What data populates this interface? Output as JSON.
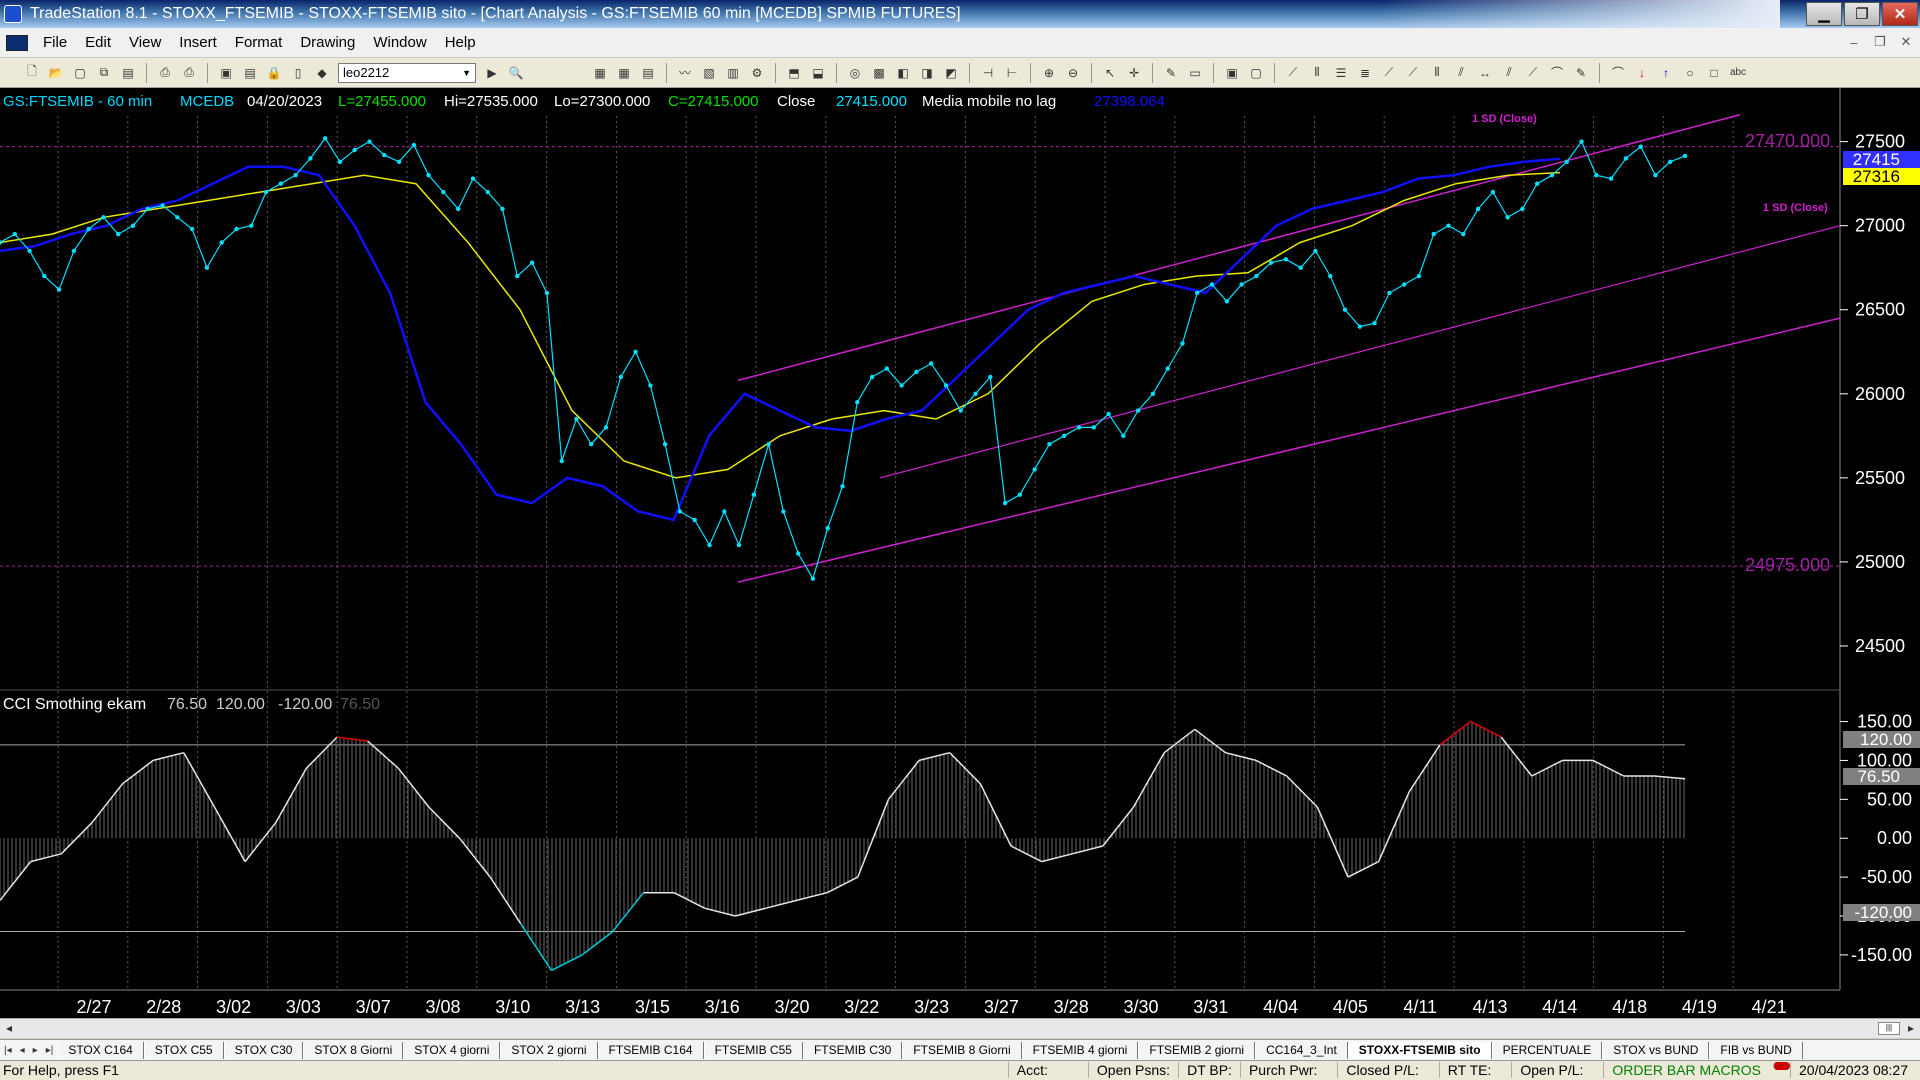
{
  "window": {
    "title": "TradeStation 8.1 - STOXX_FTSEMIB - STOXX-FTSEMIB sito - [Chart Analysis - GS:FTSEMIB  60 min  [MCEDB] SPMIB FUTURES]",
    "min": "▁",
    "max": "❐",
    "close": "✕"
  },
  "menu": [
    "File",
    "Edit",
    "View",
    "Insert",
    "Format",
    "Drawing",
    "Window",
    "Help"
  ],
  "toolbar": {
    "symbol": "leo2212"
  },
  "chart": {
    "header": {
      "symbol": "GS:FTSEMIB - 60 min",
      "exchange": "MCEDB",
      "date": "04/20/2023",
      "last": "L=27455.000",
      "hi": "Hi=27535.000",
      "lo": "Lo=27300.000",
      "close": "C=27415.000",
      "close_label": "Close",
      "close_value": "27415.000",
      "ma_label": "Media mobile no lag",
      "ma_value": "27398.064"
    },
    "channel_label_top": "1 SD (Close)",
    "channel_label_bottom": "1 SD (Close)",
    "level_high": "27470.000",
    "level_low": "24975.000",
    "price_badges": {
      "close": "27415",
      "ma": "27316"
    },
    "colors": {
      "price": "#00e0ff",
      "ma_blue": "#1010ff",
      "ma_yellow": "#e8e800",
      "channel": "#d020d0",
      "cci": "#e6e6e6",
      "cci_hot": "#e00000",
      "cci_cold": "#00c8d8"
    },
    "cci": {
      "title": "CCI Smothing ekam",
      "values": [
        "76.50",
        "120.00",
        "-120.00",
        "76.50"
      ],
      "badges": [
        "120.00",
        "76.50",
        "-120.00"
      ]
    }
  },
  "chart_data": [
    {
      "type": "line",
      "title": "",
      "x_ticks": [
        "2/27",
        "2/28",
        "3/02",
        "3/03",
        "3/07",
        "3/08",
        "3/10",
        "3/13",
        "3/15",
        "3/16",
        "3/20",
        "3/22",
        "3/23",
        "3/27",
        "3/28",
        "3/30",
        "3/31",
        "4/04",
        "4/05",
        "4/11",
        "4/13",
        "4/14",
        "4/18",
        "4/19",
        "4/21"
      ],
      "y_ticks": [
        27500,
        27000,
        26500,
        26000,
        25500,
        25000,
        24500
      ],
      "ylim": [
        24250,
        27700
      ],
      "series": [
        {
          "name": "Close",
          "values": [
            26900,
            26950,
            26850,
            26700,
            26620,
            26850,
            26980,
            27050,
            26950,
            27000,
            27100,
            27120,
            27050,
            26980,
            26750,
            26900,
            26980,
            27000,
            27200,
            27250,
            27300,
            27400,
            27520,
            27380,
            27450,
            27500,
            27420,
            27380,
            27480,
            27300,
            27200,
            27100,
            27280,
            27200,
            27100,
            26700,
            26780,
            26600,
            25600,
            25850,
            25700,
            25800,
            26100,
            26250,
            26050,
            25700,
            25300,
            25250,
            25100,
            25300,
            25100,
            25400,
            25700,
            25300,
            25050,
            24900,
            25200,
            25450,
            25950,
            26100,
            26150,
            26050,
            26130,
            26180,
            26050,
            25900,
            26000,
            26100,
            25350,
            25400,
            25550,
            25700,
            25750,
            25800,
            25800,
            25880,
            25750,
            25900,
            26000,
            26150,
            26300,
            26600,
            26650,
            26550,
            26650,
            26700,
            26780,
            26800,
            26750,
            26850,
            26700,
            26500,
            26400,
            26420,
            26600,
            26650,
            26700,
            26950,
            27000,
            26950,
            27100,
            27200,
            27050,
            27100,
            27250,
            27300,
            27380,
            27500,
            27300,
            27280,
            27400,
            27470,
            27300,
            27380,
            27415
          ]
        },
        {
          "name": "Media mobile no lag",
          "values": [
            26850,
            26880,
            26950,
            27000,
            27100,
            27150,
            27250,
            27350,
            27350,
            27300,
            27000,
            26600,
            25950,
            25700,
            25400,
            25350,
            25500,
            25450,
            25300,
            25250,
            25750,
            26000,
            25900,
            25800,
            25780,
            25850,
            25900,
            26100,
            26300,
            26500,
            26600,
            26650,
            26700,
            26650,
            26600,
            26800,
            27000,
            27100,
            27150,
            27200,
            27280,
            27300,
            27350,
            27380,
            27398
          ]
        },
        {
          "name": "",
          "values": [
            26900,
            26950,
            27050,
            27100,
            27150,
            27200,
            27250,
            27300,
            27250,
            26900,
            26500,
            25900,
            25600,
            25500,
            25550,
            25750,
            25850,
            25900,
            25850,
            26000,
            26300,
            26550,
            26650,
            26700,
            26720,
            26900,
            27000,
            27150,
            27250,
            27300,
            27316
          ]
        }
      ]
    },
    {
      "type": "area",
      "title": "CCI Smothing ekam",
      "y_ticks": [
        150,
        100,
        50,
        0,
        -50,
        -100,
        -150
      ],
      "ylim": [
        -190,
        170
      ],
      "levels": [
        120,
        -120
      ],
      "series": [
        {
          "name": "CCI Smothing ekam",
          "values": [
            -80,
            -30,
            -20,
            20,
            70,
            100,
            110,
            40,
            -30,
            20,
            90,
            130,
            125,
            90,
            40,
            0,
            -50,
            -110,
            -170,
            -150,
            -120,
            -70,
            -70,
            -90,
            -100,
            -90,
            -80,
            -70,
            -50,
            50,
            100,
            110,
            70,
            -10,
            -30,
            -20,
            -10,
            40,
            110,
            140,
            110,
            100,
            80,
            40,
            -50,
            -30,
            60,
            120,
            150,
            130,
            80,
            100,
            100,
            80,
            80,
            76.5
          ]
        }
      ]
    }
  ],
  "tabs": [
    "STOX C164",
    "STOX C55",
    "STOX  C30",
    "STOX  8 Giorni",
    "STOX 4 giorni",
    "STOX  2 giorni",
    "FTSEMIB C164",
    "FTSEMIB C55",
    "FTSEMIB C30",
    "FTSEMIB  8 Giorni",
    "FTSEMIB  4 giorni",
    "FTSEMIB  2 giorni",
    "CC164_3_Int",
    "STOXX-FTSEMIB sito",
    "PERCENTUALE",
    "STOX vs BUND",
    "FIB vs BUND"
  ],
  "active_tab": "STOXX-FTSEMIB sito",
  "status": {
    "help": "For Help, press F1",
    "acct": "Acct:",
    "open_psns": "Open Psns:",
    "dt_bp": "DT BP:",
    "purch_pwr": "Purch Pwr:",
    "closed_pl": "Closed P/L:",
    "rt_te": "RT TE:",
    "open_pl": "Open P/L:",
    "mode": "ORDER BAR  MACROS",
    "datetime": "20/04/2023 08:27"
  }
}
